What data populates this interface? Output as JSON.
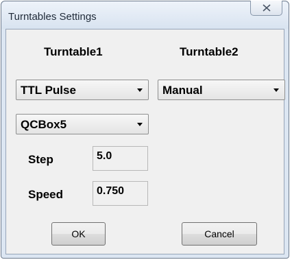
{
  "window": {
    "title": "Turntables Settings",
    "close_icon": "close-icon"
  },
  "turntable1": {
    "heading": "Turntable1",
    "mode_selected": "TTL Pulse",
    "device_selected": "QCBox5"
  },
  "turntable2": {
    "heading": "Turntable2",
    "mode_selected": "Manual"
  },
  "step": {
    "label": "Step",
    "value": "5.0"
  },
  "speed": {
    "label": "Speed",
    "value": "0.750"
  },
  "buttons": {
    "ok": "OK",
    "cancel": "Cancel"
  }
}
